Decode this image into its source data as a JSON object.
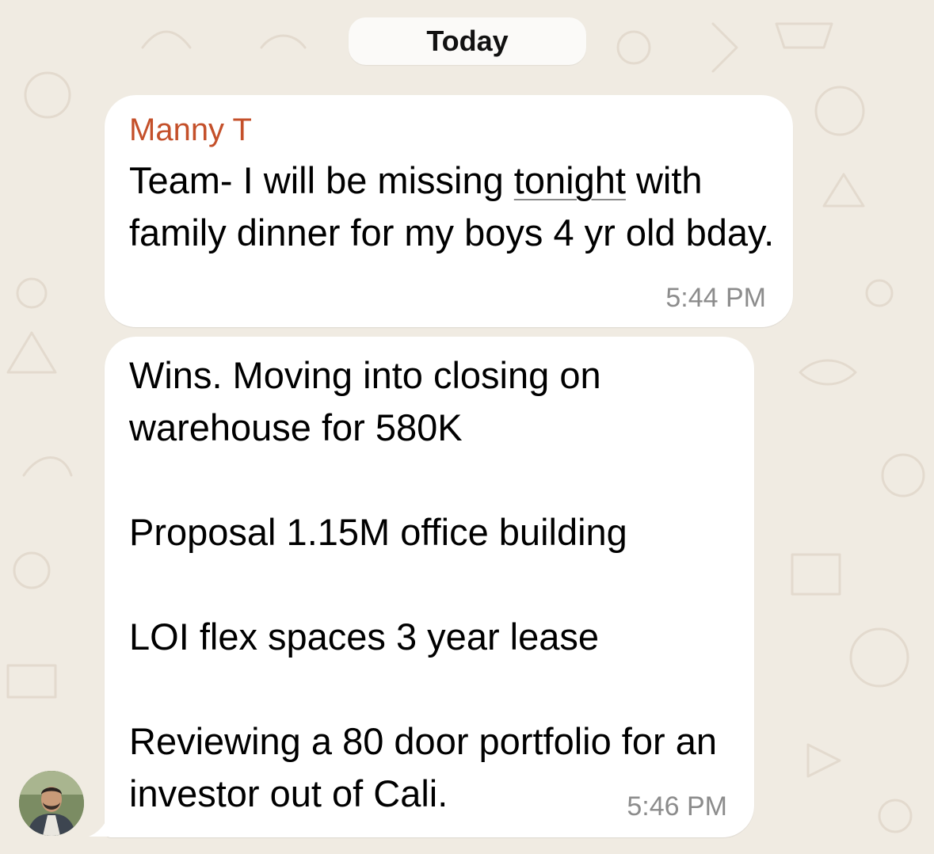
{
  "date_separator": "Today",
  "messages": [
    {
      "sender": "Manny T",
      "text_before": "Team- I will be missing ",
      "text_linked": "tonight",
      "text_after": " with family dinner for my boys 4 yr old bday.",
      "time": "5:44 PM"
    },
    {
      "text": "Wins. Moving into closing on warehouse for 580K\n\nProposal 1.15M office building\n\nLOI flex spaces 3 year lease\n\nReviewing a 80 door portfolio for an investor out of Cali.",
      "time": "5:46 PM"
    }
  ],
  "colors": {
    "wallpaper": "#f0ebe2",
    "bubble": "#ffffff",
    "sender_name": "#c4502a",
    "timestamp": "#8c8c8c"
  },
  "icons": [
    "avatar"
  ]
}
